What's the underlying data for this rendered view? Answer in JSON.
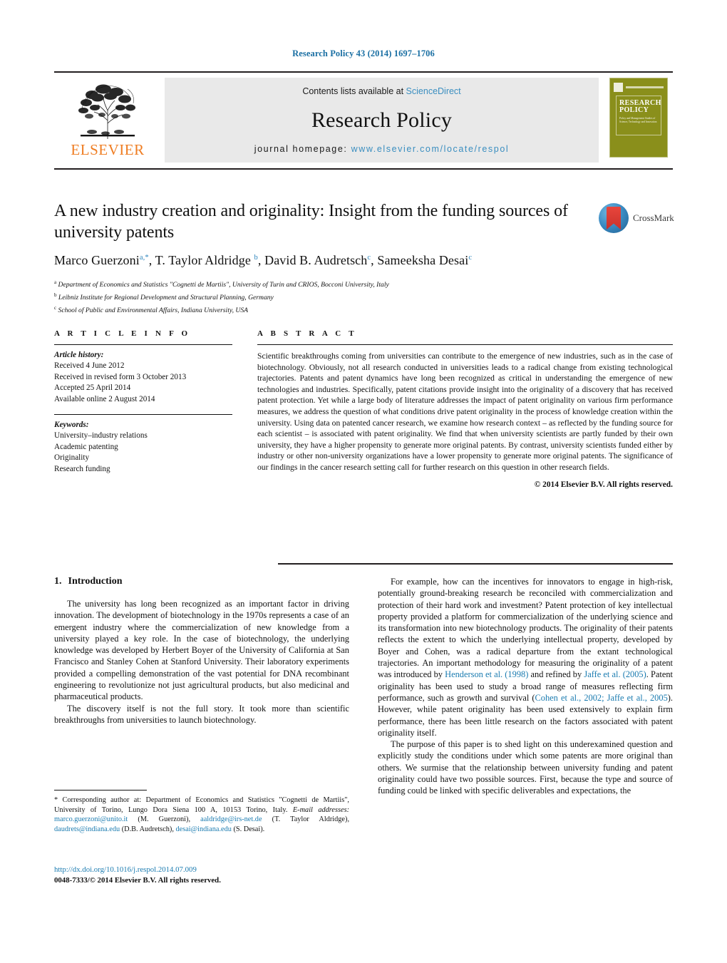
{
  "running_head": "Research Policy 43 (2014) 1697–1706",
  "masthead": {
    "publisher_logo_label": "ELSEVIER",
    "contents_prefix": "Contents lists available at",
    "contents_link": "ScienceDirect",
    "journal_name": "Research Policy",
    "homepage_prefix": "journal homepage:",
    "homepage_url": "www.elsevier.com/locate/respol",
    "cover_title_line1": "RESEARCH",
    "cover_title_line2": "POLICY",
    "cover_subtitle": "Policy and Management Studies of Science, Technology and Innovation"
  },
  "article": {
    "title": "A new industry creation and originality: Insight from the funding sources of university patents",
    "crossmark_label": "CrossMark",
    "authors_html": "Marco Guerzoni<sup>a,*</sup>, T. Taylor Aldridge <sup>b</sup>, David B. Audretsch<sup>c</sup>, Sameeksha Desai<sup>c</sup>",
    "affiliations": [
      {
        "marker": "a",
        "text": "Department of Economics and Statistics \"Cognetti de Martiis\", University of Turin and CRIOS, Bocconi University, Italy"
      },
      {
        "marker": "b",
        "text": "Leibniz Institute for Regional Development and Structural Planning, Germany"
      },
      {
        "marker": "c",
        "text": "School of Public and Environmental Affairs, Indiana University, USA"
      }
    ]
  },
  "article_info": {
    "heading": "A R T I C L E   I N F O",
    "history_label": "Article history:",
    "history": [
      "Received 4 June 2012",
      "Received in revised form 3 October 2013",
      "Accepted 25 April 2014",
      "Available online 2 August 2014"
    ],
    "keywords_label": "Keywords:",
    "keywords": [
      "University–industry relations",
      "Academic patenting",
      "Originality",
      "Research funding"
    ]
  },
  "abstract": {
    "heading": "A B S T R A C T",
    "text": "Scientific breakthroughs coming from universities can contribute to the emergence of new industries, such as in the case of biotechnology. Obviously, not all research conducted in universities leads to a radical change from existing technological trajectories. Patents and patent dynamics have long been recognized as critical in understanding the emergence of new technologies and industries. Specifically, patent citations provide insight into the originality of a discovery that has received patent protection. Yet while a large body of literature addresses the impact of patent originality on various firm performance measures, we address the question of what conditions drive patent originality in the process of knowledge creation within the university. Using data on patented cancer research, we examine how research context – as reflected by the funding source for each scientist – is associated with patent originality. We find that when university scientists are partly funded by their own university, they have a higher propensity to generate more original patents. By contrast, university scientists funded either by industry or other non-university organizations have a lower propensity to generate more original patents. The significance of our findings in the cancer research setting call for further research on this question in other research fields.",
    "copyright": "© 2014 Elsevier B.V. All rights reserved."
  },
  "body": {
    "section_number": "1.",
    "section_title": "Introduction",
    "left_paragraphs": [
      "The university has long been recognized as an important factor in driving innovation. The development of biotechnology in the 1970s represents a case of an emergent industry where the commercialization of new knowledge from a university played a key role. In the case of biotechnology, the underlying knowledge was developed by Herbert Boyer of the University of California at San Francisco and Stanley Cohen at Stanford University. Their laboratory experiments provided a compelling demonstration of the vast potential for DNA recombinant engineering to revolutionize not just agricultural products, but also medicinal and pharmaceutical products.",
      "The discovery itself is not the full story. It took more than scientific breakthroughs from universities to launch biotechnology."
    ],
    "right_paragraph_1_part1": "For example, how can the incentives for innovators to engage in high-risk, potentially ground-breaking research be reconciled with commercialization and protection of their hard work and investment? Patent protection of key intellectual property provided a platform for commercialization of the underlying science and its transformation into new biotechnology products. The originality of their patents reflects the extent to which the underlying intellectual property, developed by Boyer and Cohen, was a radical departure from the extant technological trajectories. An important methodology for measuring the originality of a patent was introduced by ",
    "citation_1": "Henderson et al. (1998)",
    "right_paragraph_1_part2": " and refined by ",
    "citation_2": "Jaffe et al. (2005)",
    "right_paragraph_1_part3": ". Patent originality has been used to study a broad range of measures reflecting firm performance, such as growth and survival (",
    "citation_3": "Cohen et al., 2002; Jaffe et al., 2005",
    "right_paragraph_1_part4": "). However, while patent originality has been used extensively to explain firm performance, there has been little research on the factors associated with patent originality itself.",
    "right_paragraph_2": "The purpose of this paper is to shed light on this underexamined question and explicitly study the conditions under which some patents are more original than others. We surmise that the relationship between university funding and patent originality could have two possible sources. First, because the type and source of funding could be linked with specific deliverables and expectations, the"
  },
  "footnotes": {
    "corresponding_marker": "*",
    "corresponding_text": " Corresponding author at: Department of Economics and Statistics \"Cognetti de Martiis\", University of Torino, Lungo Dora Siena 100 A, 10153 Torino, Italy.",
    "email_label": "E-mail addresses:",
    "emails": [
      {
        "address": "marco.guerzoni@unito.it",
        "person": "(M. Guerzoni)"
      },
      {
        "address": "aaldridge@irs-net.de",
        "person": "(T. Taylor Aldridge)"
      },
      {
        "address": "daudrets@indiana.edu",
        "person": "(D.B. Audretsch)"
      },
      {
        "address": "desai@indiana.edu",
        "person": "(S. Desai)"
      }
    ]
  },
  "imprint": {
    "doi_url": "http://dx.doi.org/10.1016/j.respol.2014.07.009",
    "issn_line": "0048-7333/© 2014 Elsevier B.V. All rights reserved."
  },
  "colors": {
    "link_blue": "#1a7bb0",
    "sciencedirect_blue": "#3a8ec0",
    "elsevier_orange": "#ef7d22",
    "cover_olive": "#8a8f1b",
    "rule_black": "#231f20"
  }
}
